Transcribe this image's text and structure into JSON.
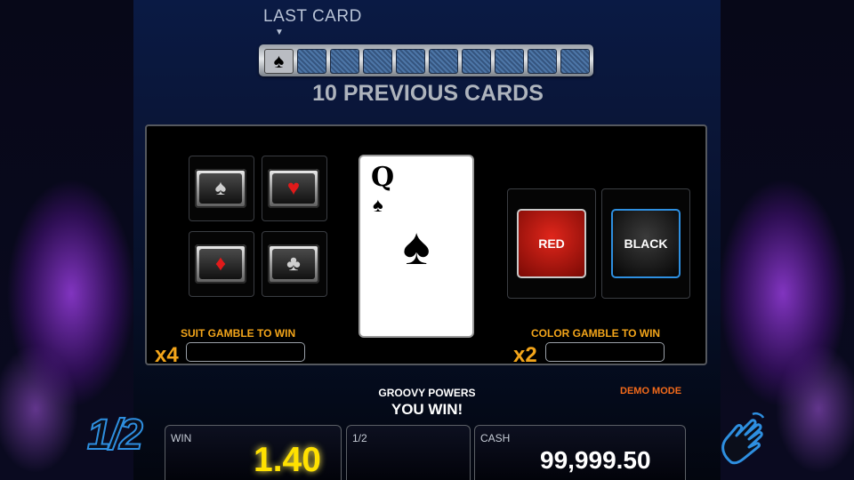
{
  "header": {
    "last_card_label": "LAST CARD",
    "previous_label": "10 PREVIOUS CARDS",
    "last_card_suit": "♠",
    "previous_cards_count_shown": 9
  },
  "suit_gamble": {
    "suits": [
      {
        "name": "spade",
        "glyph": "♠",
        "color": "#111111"
      },
      {
        "name": "heart",
        "glyph": "♥",
        "color": "#e11a1a"
      },
      {
        "name": "diamond",
        "glyph": "♦",
        "color": "#e11a1a"
      },
      {
        "name": "club",
        "glyph": "♣",
        "color": "#111111"
      }
    ],
    "label": "SUIT GAMBLE TO WIN",
    "multiplier": "x4",
    "win_value": ""
  },
  "current_card": {
    "rank": "Q",
    "suit": "♠"
  },
  "color_gamble": {
    "red_label": "RED",
    "black_label": "BLACK",
    "label": "COLOR GAMBLE TO WIN",
    "multiplier": "x2",
    "win_value": ""
  },
  "status": {
    "title": "GROOVY POWERS",
    "message": "YOU WIN!",
    "demo_label": "DEMO MODE"
  },
  "bottom": {
    "win_label": "WIN",
    "win_value": "1.40",
    "half_label": "1/2",
    "cash_label": "CASH",
    "cash_value": "99,999.50",
    "half_button_text": "1/2"
  },
  "colors": {
    "accent_orange": "#f3a51a",
    "win_yellow": "#ffe100",
    "demo_orange": "#f36a1a",
    "icon_blue": "#2e8fe0"
  },
  "icons": {
    "half_gamble": "half-gamble-icon",
    "collect": "hand-collect-icon"
  }
}
